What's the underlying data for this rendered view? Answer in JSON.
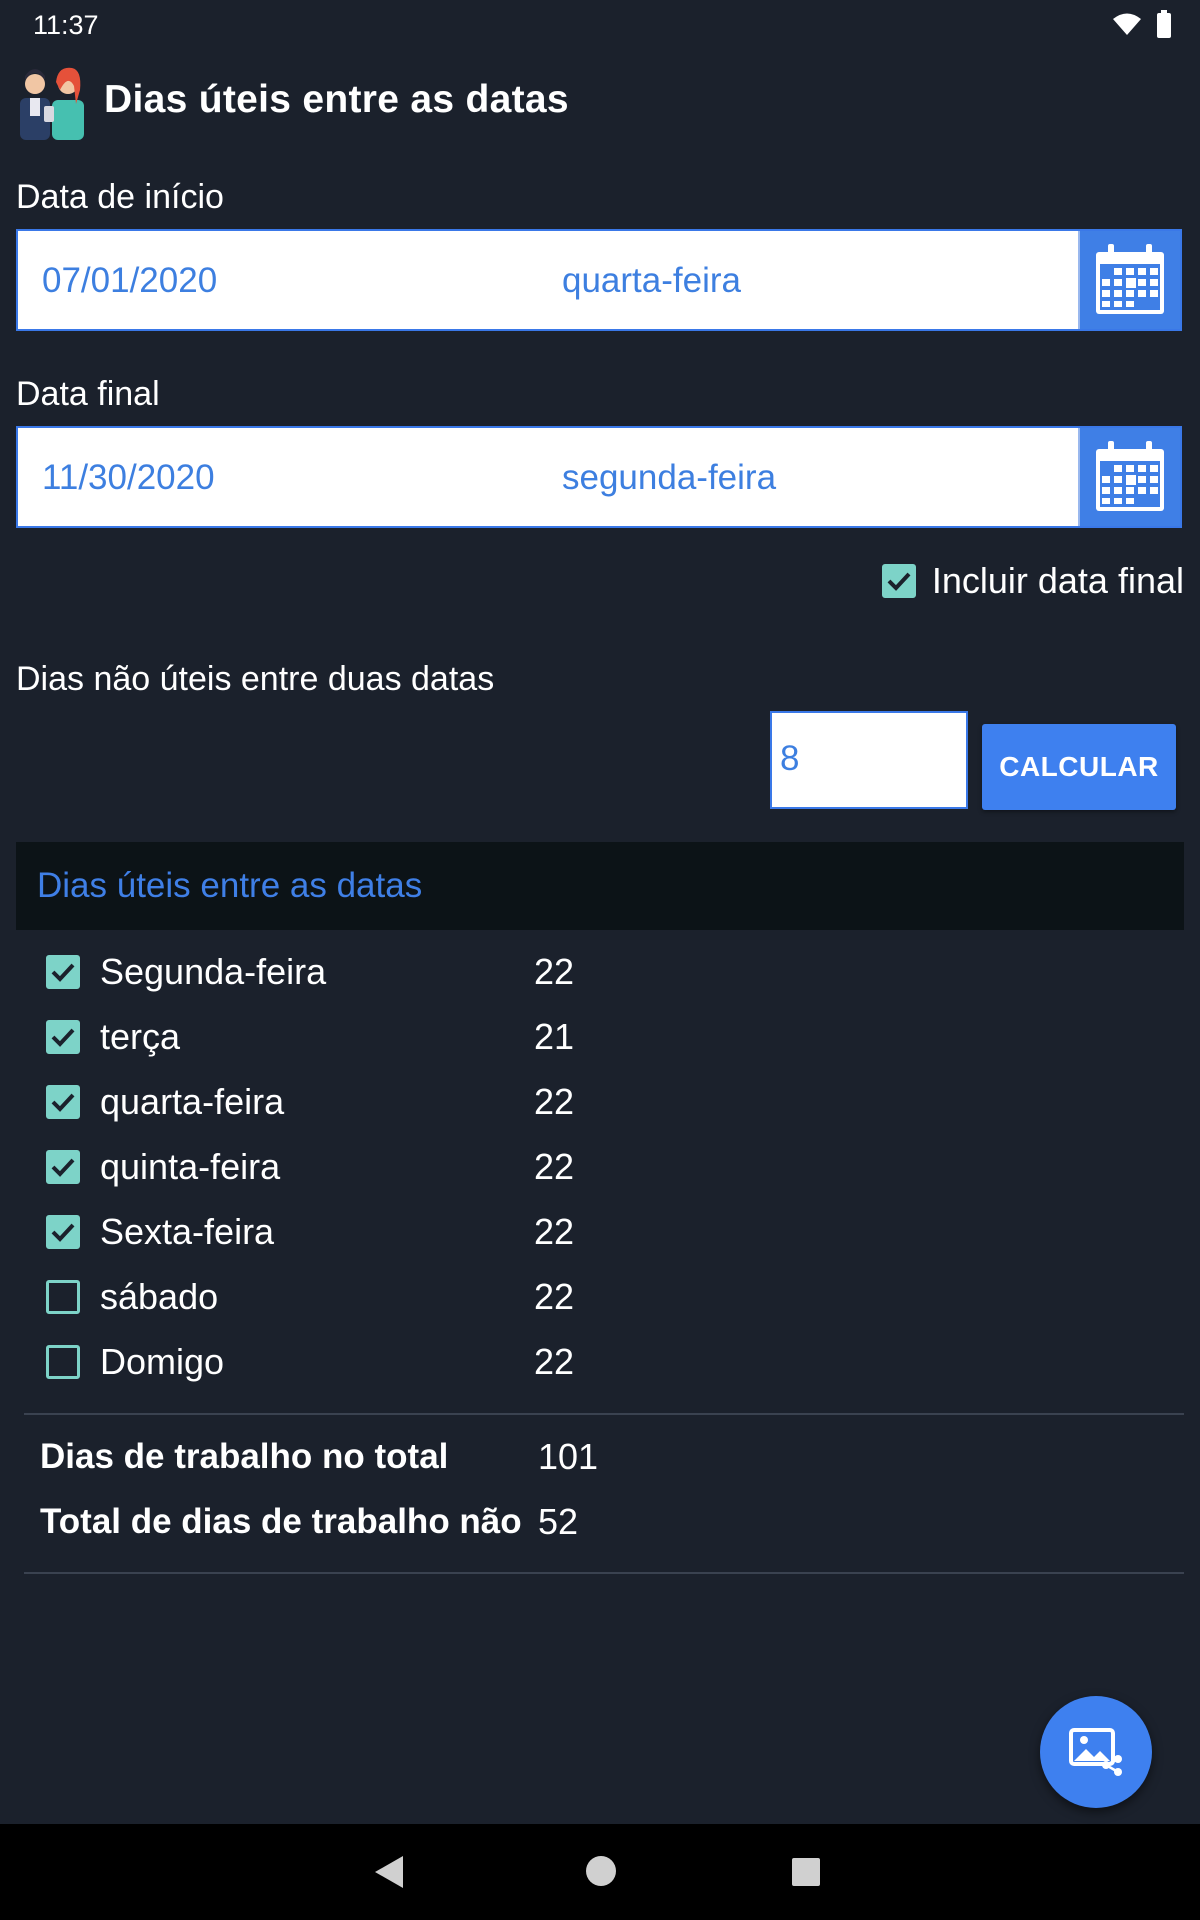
{
  "status_bar": {
    "time": "11:37"
  },
  "header": {
    "title": "Dias úteis entre as datas"
  },
  "start_date": {
    "label": "Data de início",
    "date": "07/01/2020",
    "weekday": "quarta-feira"
  },
  "end_date": {
    "label": "Data final",
    "date": "11/30/2020",
    "weekday": "segunda-feira"
  },
  "include_end": {
    "label": "Incluir data final",
    "checked": true
  },
  "non_working": {
    "label": "Dias não úteis entre duas datas",
    "value": "8",
    "button": "CALCULAR"
  },
  "results": {
    "title": "Dias úteis entre as datas",
    "days": [
      {
        "name": "Segunda-feira",
        "count": "22",
        "checked": true
      },
      {
        "name": "terça",
        "count": "21",
        "checked": true
      },
      {
        "name": "quarta-feira",
        "count": "22",
        "checked": true
      },
      {
        "name": "quinta-feira",
        "count": "22",
        "checked": true
      },
      {
        "name": "Sexta-feira",
        "count": "22",
        "checked": true
      },
      {
        "name": "sábado",
        "count": "22",
        "checked": false
      },
      {
        "name": "Domigo",
        "count": "22",
        "checked": false
      }
    ],
    "totals": [
      {
        "label": "Dias de trabalho no total",
        "value": "101"
      },
      {
        "label": "Total de dias de trabalho não",
        "value": "52"
      }
    ]
  },
  "colors": {
    "accent": "#3e80ef",
    "checkbox": "#7dd3c8",
    "background": "#1b212c"
  },
  "icons": {
    "fab": "share-image-icon",
    "calendar": "calendar-icon"
  }
}
